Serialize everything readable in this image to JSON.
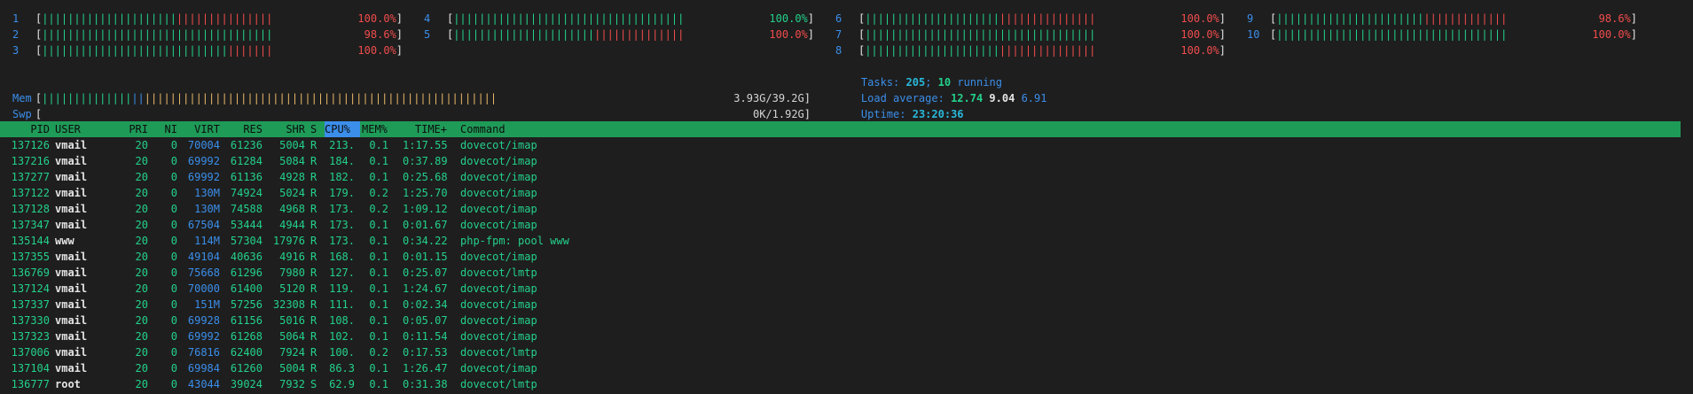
{
  "cpu_meters": [
    {
      "num": "1",
      "pct": "100.0%",
      "green_cols": 21,
      "red_cols": 15,
      "col": 1,
      "row": 0
    },
    {
      "num": "2",
      "pct": "98.6%",
      "green_cols": 36,
      "red_cols": 0,
      "col": 1,
      "row": 1
    },
    {
      "num": "3",
      "pct": "100.0%",
      "green_cols": 29,
      "red_cols": 7,
      "col": 1,
      "row": 2
    },
    {
      "num": "4",
      "pct": "100.0%",
      "green_cols": 36,
      "red_cols": 0,
      "col": 2,
      "row": 0
    },
    {
      "num": "5",
      "pct": "100.0%",
      "green_cols": 22,
      "red_cols": 14,
      "col": 2,
      "row": 1
    },
    {
      "num": "6",
      "pct": "100.0%",
      "green_cols": 21,
      "red_cols": 15,
      "col": 3,
      "row": 0
    },
    {
      "num": "7",
      "pct": "100.0%",
      "green_cols": 36,
      "red_cols": 0,
      "col": 3,
      "row": 1
    },
    {
      "num": "8",
      "pct": "100.0%",
      "green_cols": 21,
      "red_cols": 15,
      "col": 3,
      "row": 2
    },
    {
      "num": "9",
      "pct": "98.6%",
      "green_cols": 23,
      "red_cols": 13,
      "col": 4,
      "row": 0
    },
    {
      "num": "10",
      "pct": "100.0%",
      "green_cols": 36,
      "red_cols": 0,
      "col": 4,
      "row": 1
    }
  ],
  "mem": {
    "label": "Mem",
    "value": "3.93G/39.2G"
  },
  "swp": {
    "label": "Swp",
    "value": "0K/1.92G"
  },
  "tasks": {
    "label": "Tasks:",
    "count": "205",
    "sep": ";",
    "running": "10",
    "running_label": "running"
  },
  "load": {
    "label": "Load average:",
    "one": "12.74",
    "five": "9.04",
    "fifteen": "6.91"
  },
  "uptime": {
    "label": "Uptime:",
    "value": "23:20:36"
  },
  "columns": {
    "pid": "PID",
    "user": "USER",
    "pri": "PRI",
    "ni": "NI",
    "virt": "VIRT",
    "res": "RES",
    "shr": "SHR",
    "s": "S",
    "cpu": "CPU%",
    "mem": "MEM%",
    "time": "TIME+",
    "command": "Command"
  },
  "processes": [
    {
      "pid": "137126",
      "user": "vmail",
      "pri": "20",
      "ni": "0",
      "virt": "70004",
      "res": "61236",
      "shr": "5004",
      "s": "R",
      "cpu": "213.",
      "mem": "0.1",
      "time": "1:17.55",
      "command": "dovecot/imap"
    },
    {
      "pid": "137216",
      "user": "vmail",
      "pri": "20",
      "ni": "0",
      "virt": "69992",
      "res": "61284",
      "shr": "5084",
      "s": "R",
      "cpu": "184.",
      "mem": "0.1",
      "time": "0:37.89",
      "command": "dovecot/imap"
    },
    {
      "pid": "137277",
      "user": "vmail",
      "pri": "20",
      "ni": "0",
      "virt": "69992",
      "res": "61136",
      "shr": "4928",
      "s": "R",
      "cpu": "182.",
      "mem": "0.1",
      "time": "0:25.68",
      "command": "dovecot/imap"
    },
    {
      "pid": "137122",
      "user": "vmail",
      "pri": "20",
      "ni": "0",
      "virt": "130M",
      "res": "74924",
      "shr": "5024",
      "s": "R",
      "cpu": "179.",
      "mem": "0.2",
      "time": "1:25.70",
      "command": "dovecot/imap"
    },
    {
      "pid": "137128",
      "user": "vmail",
      "pri": "20",
      "ni": "0",
      "virt": "130M",
      "res": "74588",
      "shr": "4968",
      "s": "R",
      "cpu": "173.",
      "mem": "0.2",
      "time": "1:09.12",
      "command": "dovecot/imap"
    },
    {
      "pid": "137347",
      "user": "vmail",
      "pri": "20",
      "ni": "0",
      "virt": "67504",
      "res": "53444",
      "shr": "4944",
      "s": "R",
      "cpu": "173.",
      "mem": "0.1",
      "time": "0:01.67",
      "command": "dovecot/imap"
    },
    {
      "pid": "135144",
      "user": "www",
      "pri": "20",
      "ni": "0",
      "virt": "114M",
      "res": "57304",
      "shr": "17976",
      "s": "R",
      "cpu": "173.",
      "mem": "0.1",
      "time": "0:34.22",
      "command": "php-fpm: pool www"
    },
    {
      "pid": "137355",
      "user": "vmail",
      "pri": "20",
      "ni": "0",
      "virt": "49104",
      "res": "40636",
      "shr": "4916",
      "s": "R",
      "cpu": "168.",
      "mem": "0.1",
      "time": "0:01.15",
      "command": "dovecot/imap"
    },
    {
      "pid": "136769",
      "user": "vmail",
      "pri": "20",
      "ni": "0",
      "virt": "75668",
      "res": "61296",
      "shr": "7980",
      "s": "R",
      "cpu": "127.",
      "mem": "0.1",
      "time": "0:25.07",
      "command": "dovecot/lmtp"
    },
    {
      "pid": "137124",
      "user": "vmail",
      "pri": "20",
      "ni": "0",
      "virt": "70000",
      "res": "61400",
      "shr": "5120",
      "s": "R",
      "cpu": "119.",
      "mem": "0.1",
      "time": "1:24.67",
      "command": "dovecot/imap"
    },
    {
      "pid": "137337",
      "user": "vmail",
      "pri": "20",
      "ni": "0",
      "virt": "151M",
      "res": "57256",
      "shr": "32308",
      "s": "R",
      "cpu": "111.",
      "mem": "0.1",
      "time": "0:02.34",
      "command": "dovecot/imap"
    },
    {
      "pid": "137330",
      "user": "vmail",
      "pri": "20",
      "ni": "0",
      "virt": "69928",
      "res": "61156",
      "shr": "5016",
      "s": "R",
      "cpu": "108.",
      "mem": "0.1",
      "time": "0:05.07",
      "command": "dovecot/imap"
    },
    {
      "pid": "137323",
      "user": "vmail",
      "pri": "20",
      "ni": "0",
      "virt": "69992",
      "res": "61268",
      "shr": "5064",
      "s": "R",
      "cpu": "102.",
      "mem": "0.1",
      "time": "0:11.54",
      "command": "dovecot/imap"
    },
    {
      "pid": "137006",
      "user": "vmail",
      "pri": "20",
      "ni": "0",
      "virt": "76816",
      "res": "62400",
      "shr": "7924",
      "s": "R",
      "cpu": "100.",
      "mem": "0.2",
      "time": "0:17.53",
      "command": "dovecot/lmtp"
    },
    {
      "pid": "137104",
      "user": "vmail",
      "pri": "20",
      "ni": "0",
      "virt": "69984",
      "res": "61260",
      "shr": "5004",
      "s": "R",
      "cpu": "86.3",
      "mem": "0.1",
      "time": "1:26.47",
      "command": "dovecot/imap"
    },
    {
      "pid": "136777",
      "user": "root",
      "pri": "20",
      "ni": "0",
      "virt": "43044",
      "res": "39024",
      "shr": "7932",
      "s": "S",
      "cpu": "62.9",
      "mem": "0.1",
      "time": "0:31.38",
      "command": "dovecot/lmtp"
    }
  ],
  "colors": {
    "background": "#1e1e1e",
    "header_bg": "#1f9b58",
    "selected_col_bg": "#3b8eea",
    "green": "#23d18b",
    "red": "#f14c4c",
    "blue": "#3b8eea",
    "orange": "#e5b567"
  }
}
